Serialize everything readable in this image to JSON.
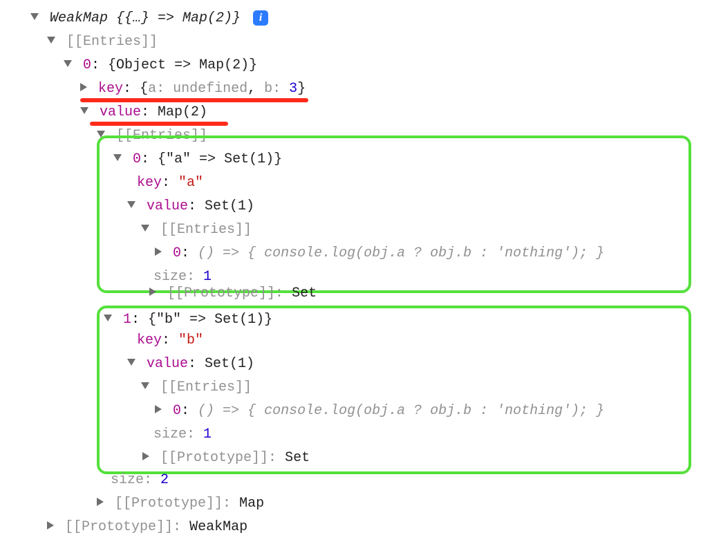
{
  "root": {
    "label": "WeakMap {{…} => Map(2)}",
    "entries_label": "[[Entries]]",
    "entry0": {
      "header": "{Object => Map(2)}",
      "key_label": "key",
      "key_preview": "{a: undefined, b: 3}",
      "key_a_label": "a",
      "key_a_val": "undefined",
      "key_b_label": "b",
      "key_b_val": "3",
      "value_label": "value",
      "value_preview": "Map(2)",
      "map": {
        "entries_label": "[[Entries]]",
        "e0": {
          "header": "{\"a\" => Set(1)}",
          "key_label": "key",
          "key_val": "\"a\"",
          "value_label": "value",
          "value_preview": "Set(1)",
          "entries_label": "[[Entries]]",
          "fn": "() => { console.log(obj.a ? obj.b : 'nothing'); }",
          "size_label": "size",
          "size_val": "1",
          "proto_label": "[[Prototype]]",
          "proto_val": "Set"
        },
        "e1": {
          "header": "{\"b\" => Set(1)}",
          "key_label": "key",
          "key_val": "\"b\"",
          "value_label": "value",
          "value_preview": "Set(1)",
          "entries_label": "[[Entries]]",
          "fn": "() => { console.log(obj.a ? obj.b : 'nothing'); }",
          "size_label": "size",
          "size_val": "1",
          "proto_label": "[[Prototype]]",
          "proto_val": "Set"
        },
        "size_label": "size",
        "size_val": "2",
        "proto_label": "[[Prototype]]",
        "proto_val": "Map"
      }
    },
    "proto_label": "[[Prototype]]",
    "proto_val": "WeakMap"
  },
  "info_glyph": "i"
}
